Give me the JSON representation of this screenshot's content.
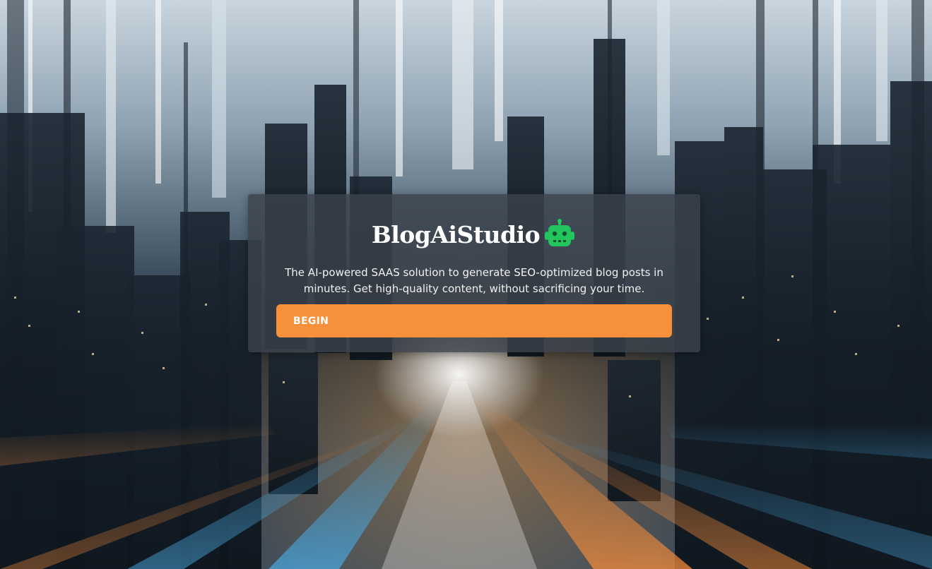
{
  "brand": {
    "name": "BlogAiStudio",
    "icon": "robot-icon",
    "icon_color": "#22c55e"
  },
  "tagline": "The AI-powered SAAS solution to generate SEO-optimized blog posts in minutes. Get high-quality content, without sacrificing your time.",
  "cta": {
    "label": "BEGIN",
    "color": "#f7903a"
  },
  "background": {
    "description_icon": "city-light-streaks-image"
  }
}
